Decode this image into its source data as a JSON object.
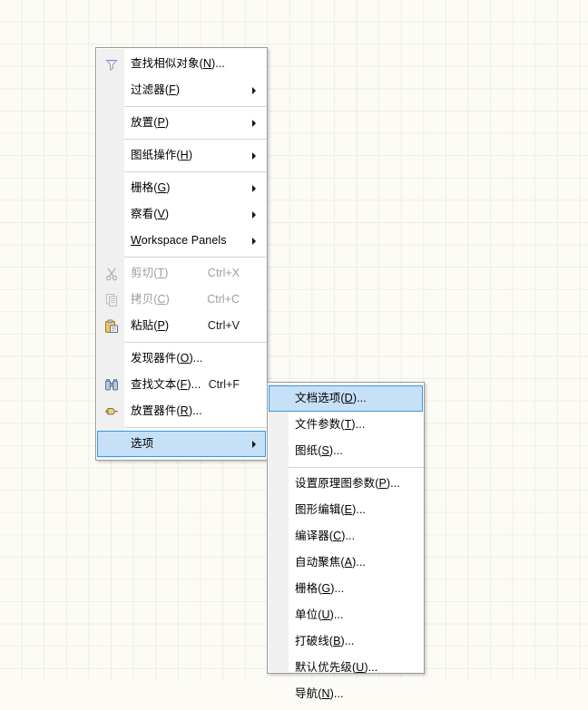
{
  "canvas": {
    "background_color": "#fdfbf6",
    "grid_line_color": "#eceee8",
    "grid_spacing_px": 25
  },
  "theme": {
    "menu_background": "#ffffff",
    "menu_border": "#9a9a9a",
    "gutter_background": "#f0f0f0",
    "highlight_fill": "#c6e0f8",
    "highlight_border": "#3a96dd",
    "separator_color": "#d3d3d3",
    "text_color": "#000000",
    "disabled_text_color": "#9d9d9d"
  },
  "context_menu": {
    "name": "schematic-right-click-menu",
    "items": [
      {
        "id": "find-similar-objects",
        "label": "查找相似对象(N)...",
        "icon": "filter-funnel-icon",
        "type": "item",
        "enabled": true,
        "shortcut": "",
        "submenu": false,
        "selected": false
      },
      {
        "id": "filters",
        "label": "过滤器(F)",
        "icon": "",
        "type": "item",
        "enabled": true,
        "shortcut": "",
        "submenu": true,
        "selected": false
      },
      {
        "id": "sep-1",
        "type": "separator"
      },
      {
        "id": "place",
        "label": "放置(P)",
        "icon": "",
        "type": "item",
        "enabled": true,
        "shortcut": "",
        "submenu": true,
        "selected": false
      },
      {
        "id": "sep-2",
        "type": "separator"
      },
      {
        "id": "sheet-actions",
        "label": "图纸操作(H)",
        "icon": "",
        "type": "item",
        "enabled": true,
        "shortcut": "",
        "submenu": true,
        "selected": false
      },
      {
        "id": "sep-3",
        "type": "separator"
      },
      {
        "id": "snap-grid",
        "label": "栅格(G)",
        "icon": "",
        "type": "item",
        "enabled": true,
        "shortcut": "",
        "submenu": true,
        "selected": false
      },
      {
        "id": "view",
        "label": "察看(V)",
        "icon": "",
        "type": "item",
        "enabled": true,
        "shortcut": "",
        "submenu": true,
        "selected": false
      },
      {
        "id": "workspace-panels",
        "label": "Workspace Panels",
        "icon": "",
        "type": "item",
        "enabled": true,
        "shortcut": "",
        "submenu": true,
        "selected": false
      },
      {
        "id": "sep-4",
        "type": "separator"
      },
      {
        "id": "cut",
        "label": "剪切(T)",
        "icon": "scissors-icon",
        "type": "item",
        "enabled": false,
        "shortcut": "Ctrl+X",
        "submenu": false,
        "selected": false
      },
      {
        "id": "copy",
        "label": "拷贝(C)",
        "icon": "copy-pages-icon",
        "type": "item",
        "enabled": false,
        "shortcut": "Ctrl+C",
        "submenu": false,
        "selected": false
      },
      {
        "id": "paste",
        "label": "粘贴(P)",
        "icon": "clipboard-paste-icon",
        "type": "item",
        "enabled": true,
        "shortcut": "Ctrl+V",
        "submenu": false,
        "selected": false
      },
      {
        "id": "sep-5",
        "type": "separator"
      },
      {
        "id": "discover-components",
        "label": "发现器件(O)...",
        "icon": "",
        "type": "item",
        "enabled": true,
        "shortcut": "",
        "submenu": false,
        "selected": false
      },
      {
        "id": "find-text",
        "label": "查找文本(F)...",
        "icon": "binoculars-icon",
        "type": "item",
        "enabled": true,
        "shortcut": "Ctrl+F",
        "submenu": false,
        "selected": false
      },
      {
        "id": "place-component",
        "label": "放置器件(R)...",
        "icon": "component-pin-icon",
        "type": "item",
        "enabled": true,
        "shortcut": "",
        "submenu": false,
        "selected": false
      },
      {
        "id": "sep-6",
        "type": "separator"
      },
      {
        "id": "options",
        "label": "选项",
        "icon": "",
        "type": "item",
        "enabled": true,
        "shortcut": "",
        "submenu": true,
        "selected": true
      }
    ]
  },
  "options_submenu": {
    "name": "options-submenu",
    "parent_item": "选项",
    "items": [
      {
        "id": "document-options",
        "label": "文档选项(D)...",
        "type": "item",
        "enabled": true,
        "selected": true
      },
      {
        "id": "file-parameters",
        "label": "文件参数(T)...",
        "type": "item",
        "enabled": true,
        "selected": false
      },
      {
        "id": "sheet",
        "label": "图纸(S)...",
        "type": "item",
        "enabled": true,
        "selected": false
      },
      {
        "id": "sub-sep-1",
        "type": "separator"
      },
      {
        "id": "schematic-preferences",
        "label": "设置原理图参数(P)...",
        "type": "item",
        "enabled": true,
        "selected": false
      },
      {
        "id": "graphical-editing",
        "label": "图形编辑(E)...",
        "type": "item",
        "enabled": true,
        "selected": false
      },
      {
        "id": "compiler",
        "label": "编译器(C)...",
        "type": "item",
        "enabled": true,
        "selected": false
      },
      {
        "id": "auto-focus",
        "label": "自动聚焦(A)...",
        "type": "item",
        "enabled": true,
        "selected": false
      },
      {
        "id": "grids",
        "label": "栅格(G)...",
        "type": "item",
        "enabled": true,
        "selected": false
      },
      {
        "id": "units",
        "label": "单位(U)...",
        "type": "item",
        "enabled": true,
        "selected": false
      },
      {
        "id": "break-wire",
        "label": "打破线(B)...",
        "type": "item",
        "enabled": true,
        "selected": false
      },
      {
        "id": "default-prim",
        "label": "默认优先级(U)...",
        "type": "item",
        "enabled": true,
        "selected": false
      },
      {
        "id": "navigation",
        "label": "导航(N)...",
        "type": "item",
        "enabled": true,
        "selected": false
      }
    ]
  }
}
